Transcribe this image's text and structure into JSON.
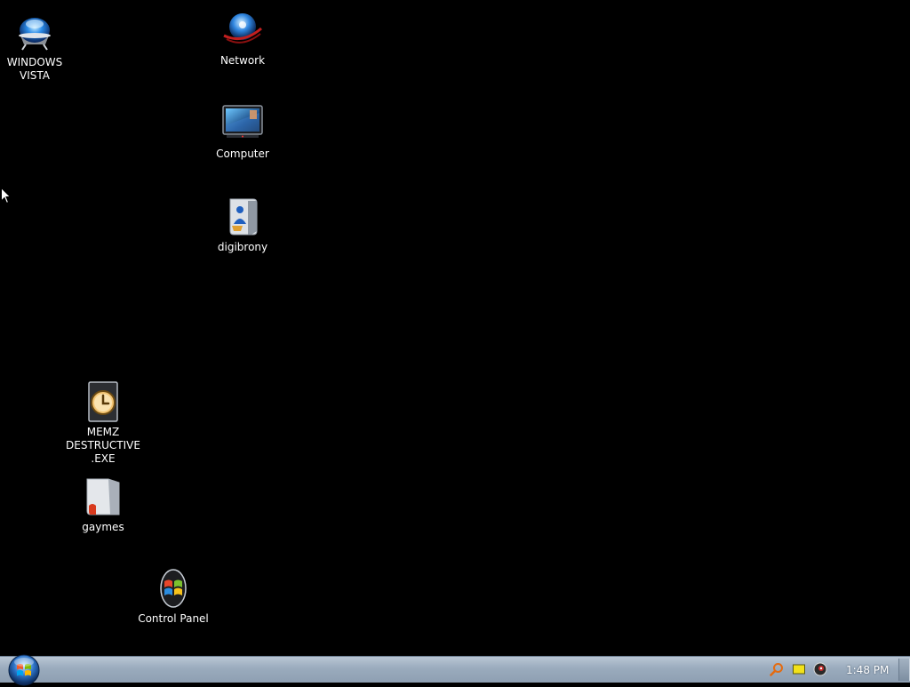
{
  "desktop": {
    "icons": [
      {
        "label": "WINDOWS\nVISTA",
        "icon": "vista-orb-icon"
      },
      {
        "label": "Network",
        "icon": "network-globe-icon"
      },
      {
        "label": "Computer",
        "icon": "computer-monitor-icon"
      },
      {
        "label": "digibrony",
        "icon": "user-folder-icon"
      },
      {
        "label": "MEMZ\nDESTRUCTIVE\n.EXE",
        "icon": "executable-file-icon"
      },
      {
        "label": "gaymes",
        "icon": "folder-icon"
      },
      {
        "label": "Control Panel",
        "icon": "control-panel-icon"
      }
    ]
  },
  "taskbar": {
    "start_icon": "windows-orb-icon",
    "tray_icons": [
      "search-icon",
      "message-icon",
      "volume-icon"
    ],
    "clock": "1:48 PM"
  },
  "colors": {
    "desktop_background": "#000000",
    "taskbar": "#9aabbd",
    "label_text": "#ffffff"
  }
}
